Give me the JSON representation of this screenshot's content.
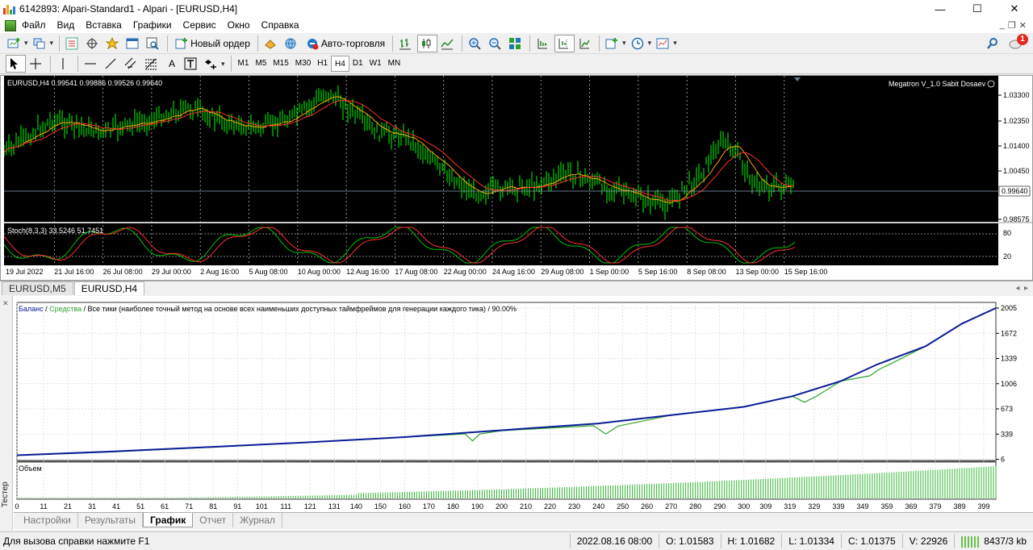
{
  "window": {
    "title": "6142893: Alpari-Standard1 - Alpari - [EURUSD,H4]",
    "controls": {
      "minimize": "—",
      "maximize": "☐",
      "close": "✕"
    }
  },
  "menu": {
    "items": [
      "Файл",
      "Вид",
      "Вставка",
      "Графики",
      "Сервис",
      "Окно",
      "Справка"
    ]
  },
  "toolbar1": {
    "new_order_label": "Новый ордер",
    "auto_trading_label": "Авто-торговля",
    "notification_count": "1"
  },
  "toolbar2": {
    "tool_a_label": "A",
    "timeframes": [
      "M1",
      "M5",
      "M15",
      "M30",
      "H1",
      "H4",
      "D1",
      "W1",
      "MN"
    ],
    "active_timeframe": "H4"
  },
  "price_chart": {
    "symbol_info": "EURUSD,H4  0.99541 0.99886 0.99526 0.99640",
    "indicator_label": "Megatron V_1.0 Sabit Dosaev",
    "current_price": "0.99640",
    "price_levels": [
      "1.03300",
      "1.02350",
      "1.01400",
      "1.00450",
      "0.99640",
      "0.98575"
    ],
    "time_labels": [
      "19 Jul 2022",
      "21 Jul 16:00",
      "26 Jul 08:00",
      "29 Jul 00:00",
      "2 Aug 16:00",
      "5 Aug 08:00",
      "10 Aug 00:00",
      "12 Aug 16:00",
      "17 Aug 08:00",
      "22 Aug 00:00",
      "24 Aug 16:00",
      "29 Aug 08:00",
      "1 Sep 00:00",
      "5 Sep 16:00",
      "8 Sep 08:00",
      "13 Sep 00:00",
      "15 Sep 16:00"
    ],
    "stoch_label": "Stoch(8,3,3) 33.5246 51.7451",
    "stoch_levels": [
      "80",
      "20"
    ],
    "colors": {
      "background": "#000000",
      "bars": "#00ff00",
      "ma_fast": "#ffa500",
      "ma_slow": "#ff3030",
      "stoch_main": "#00c000",
      "stoch_signal": "#ff3030"
    }
  },
  "chart_tabs": [
    "EURUSD,M5",
    "EURUSD,H4"
  ],
  "active_chart_tab": "EURUSD,H4",
  "tester": {
    "side_label": "Тестер",
    "legend_balance": "Баланс",
    "legend_sep1": " / ",
    "legend_equity": "Средства",
    "legend_rest": " / Все тики (наиболее точный метод на основе всех наименьших доступных таймфреймов для генерации каждого тика) / 90.00%",
    "volume_label": "Объем",
    "tabs": [
      "Настройки",
      "Результаты",
      "График",
      "Отчет",
      "Журнал"
    ],
    "active_tab": "График",
    "colors": {
      "balance": "#0a1c96",
      "equity": "#2fa52f",
      "volume": "#33b533"
    }
  },
  "chart_data": {
    "type": "line",
    "title": "",
    "xlabel": "",
    "ylabel": "",
    "x_ticks": [
      0,
      11,
      21,
      31,
      41,
      51,
      61,
      71,
      81,
      91,
      101,
      111,
      121,
      131,
      140,
      150,
      160,
      170,
      180,
      190,
      200,
      210,
      220,
      230,
      240,
      250,
      260,
      270,
      280,
      290,
      300,
      309,
      319,
      329,
      339,
      349,
      359,
      369,
      379,
      389,
      399
    ],
    "y_ticks": [
      6,
      339,
      673,
      1006,
      1339,
      1672,
      2005
    ],
    "xlim": [
      0,
      404
    ],
    "ylim": [
      -20,
      2080
    ],
    "series": [
      {
        "name": "Баланс",
        "x": [
          0,
          40,
          80,
          120,
          160,
          200,
          240,
          270,
          300,
          320,
          340,
          355,
          375,
          390,
          404
        ],
        "values": [
          60,
          110,
          170,
          230,
          300,
          390,
          480,
          590,
          700,
          840,
          1040,
          1260,
          1500,
          1800,
          2005
        ]
      },
      {
        "name": "Средства",
        "x": [
          0,
          40,
          80,
          120,
          160,
          185,
          188,
          191,
          200,
          238,
          243,
          248,
          270,
          300,
          320,
          325,
          330,
          340,
          352,
          356,
          360,
          375,
          390,
          404
        ],
        "values": [
          60,
          105,
          165,
          230,
          300,
          340,
          250,
          340,
          385,
          450,
          340,
          445,
          590,
          700,
          840,
          760,
          840,
          1040,
          1110,
          1200,
          1260,
          1500,
          1800,
          2005
        ]
      }
    ]
  },
  "status": {
    "help": "Для вызова справки нажмите F1",
    "datetime": "2022.08.16 08:00",
    "open": "O: 1.01583",
    "high": "H: 1.01682",
    "low": "L: 1.01334",
    "close": "C: 1.01375",
    "volume": "V: 22926",
    "traffic": "8437/3 kb"
  }
}
